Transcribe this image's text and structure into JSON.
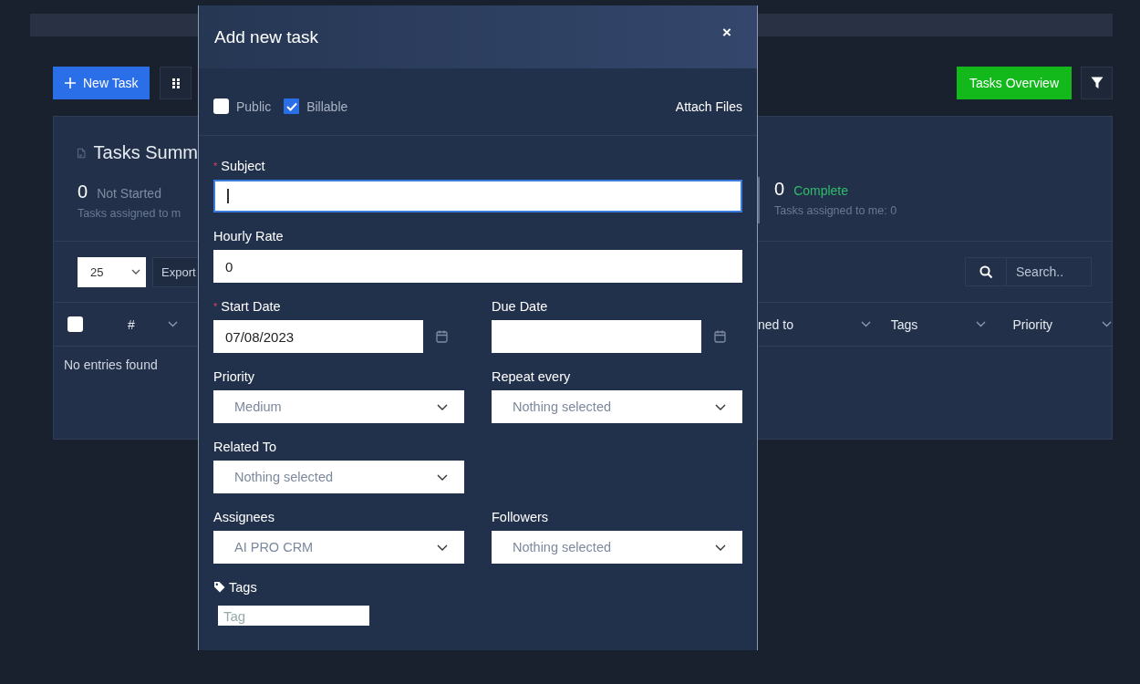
{
  "toolbar": {
    "new_task_button": "New Task",
    "tasks_overview_button": "Tasks Overview"
  },
  "summary": {
    "title": "Tasks Summ",
    "stats": [
      {
        "count": "0",
        "label": "Not Started",
        "sub": "Tasks assigned to m",
        "color": "#7f8ca3"
      },
      {
        "count": "0",
        "label": "Complete",
        "sub": "Tasks assigned to me: 0",
        "color": "#2ebd6b"
      }
    ]
  },
  "table_controls": {
    "page_size": "25",
    "export_button": "Export",
    "search_placeholder": "Search.."
  },
  "table": {
    "select_all": {
      "checked": false
    },
    "columns_left": [
      {
        "label": "#"
      }
    ],
    "columns_right": [
      {
        "label": "ned to"
      },
      {
        "label": "Tags"
      },
      {
        "label": "Priority"
      }
    ],
    "empty_message": "No entries found"
  },
  "modal": {
    "title": "Add new task",
    "close": "×",
    "options": [
      {
        "label": "Public",
        "checked": false
      },
      {
        "label": "Billable",
        "checked": true
      }
    ],
    "attach_files": "Attach Files",
    "rows": [
      [
        {
          "kind": "text",
          "label": "Subject",
          "required_mark": "*",
          "focused": true
        }
      ],
      [
        {
          "kind": "text",
          "label": "Hourly Rate",
          "focused": false,
          "value": "0"
        }
      ],
      [
        {
          "kind": "date",
          "label": "Start Date",
          "required_mark": "*",
          "value": "07/08/2023"
        },
        {
          "kind": "date",
          "label": "Due Date"
        }
      ],
      [
        {
          "kind": "select",
          "label": "Priority",
          "value": "Medium"
        },
        {
          "kind": "select",
          "label": "Repeat every",
          "value": "Nothing selected"
        }
      ],
      [
        {
          "kind": "select",
          "label": "Related To",
          "value": "Nothing selected"
        }
      ],
      [
        {
          "kind": "select",
          "label": "Assignees",
          "value": "AI PRO CRM"
        },
        {
          "kind": "select",
          "label": "Followers",
          "value": "Nothing selected"
        }
      ],
      [
        {
          "kind": "tags",
          "label": "Tags",
          "placeholder": "Tag"
        }
      ]
    ]
  }
}
